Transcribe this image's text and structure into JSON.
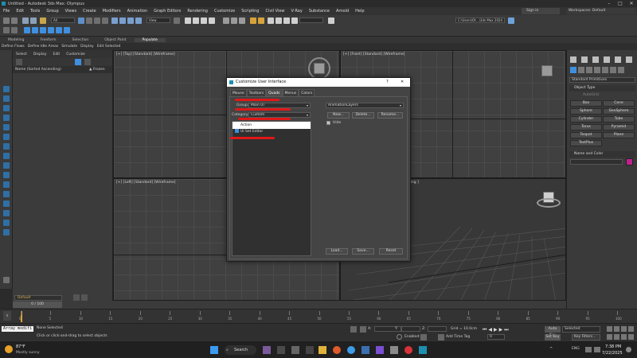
{
  "window": {
    "title": "Untitled - Autodesk 3ds Max: Olympus"
  },
  "menu": {
    "items": [
      "File",
      "Edit",
      "Tools",
      "Group",
      "Views",
      "Create",
      "Modifiers",
      "Animation",
      "Graph Editors",
      "Rendering",
      "Customize",
      "Scripting",
      "Civil View",
      "V-Ray",
      "Substance",
      "Arnold",
      "Help"
    ],
    "signin": "Sign in",
    "workspaces_label": "Workspaces:",
    "workspace_value": "Default"
  },
  "toolbar": {
    "filter_value": "All",
    "view_value": "View",
    "path_value": "C:\\Users\\Ot...\\3ds Max 2024"
  },
  "ribbon": {
    "tabs": [
      "Modeling",
      "Freeform",
      "Selection",
      "Object Paint",
      "Populate"
    ],
    "active": "Populate",
    "sub_items": [
      "Define Flows",
      "Define Idle Areas",
      "Simulate",
      "Display",
      "Edit Selected"
    ]
  },
  "explorer": {
    "tabs": [
      "Select",
      "Display",
      "Edit",
      "Customize"
    ],
    "column_name": "Name (Sorted Ascending)",
    "column_frozen": "▲ Frozen"
  },
  "viewports": {
    "top": "[+] [Top] [Standard] [Wireframe]",
    "front": "[+] [Front] [Standard] [Wireframe]",
    "left": "[+] [Left] [Standard] [Wireframe]",
    "persp_suffix": "ading ]"
  },
  "command_panel": {
    "category_value": "Standard Primitives",
    "object_type_header": "Object Type",
    "autogrid": "AutoGrid",
    "buttons": [
      "Box",
      "Cone",
      "Sphere",
      "GeoSphere",
      "Cylinder",
      "Tube",
      "Torus",
      "Pyramid",
      "Teapot",
      "Plane",
      "TextPlus"
    ],
    "name_color_header": "Name and Color",
    "name_color_swatch": "#c0218f"
  },
  "dialog": {
    "title": "Customize User Interface",
    "help": "?",
    "close": "✕",
    "tabs": [
      "Mouse",
      "Toolbars",
      "Quads",
      "Menus",
      "Colors"
    ],
    "active_tab": "Quads",
    "group_label": "Group:",
    "group_value": "Main UI",
    "category_label": "Category:",
    "category_value": "Custom",
    "list_header": "Action",
    "list_items": [
      "UI Set Editor"
    ],
    "right_dropdown": "AnimationLayers",
    "new_btn": "New...",
    "delete_btn": "Delete...",
    "rename_btn": "Rename...",
    "hide_label": "Hide",
    "load_btn": "Load...",
    "save_btn": "Save...",
    "reset_btn": "Reset"
  },
  "timeline": {
    "frame_display": "0 / 100",
    "ticks": [
      "0",
      "5",
      "10",
      "15",
      "20",
      "25",
      "30",
      "35",
      "40",
      "45",
      "50",
      "55",
      "60",
      "65",
      "70",
      "75",
      "80",
      "85",
      "90",
      "95",
      "100"
    ]
  },
  "status": {
    "layer_value": "Default",
    "none_selected": "None Selected",
    "hint": "Click or click-and-drag to select objects",
    "script": "Array modifi",
    "x_label": "X:",
    "y_label": "Y:",
    "z_label": "Z:",
    "grid": "Grid = 10.0cm",
    "enabled": "Enabled:",
    "add_time_tag": "Add Time Tag",
    "auto_key": "Auto Key",
    "set_key": "Set Key",
    "selected_value": "Selected",
    "key_filters": "Key Filters...",
    "frame_value": "0"
  },
  "taskbar": {
    "weather_temp": "87°F",
    "weather_desc": "Mostly sunny",
    "search": "Search",
    "time": "7:38 PM",
    "date": "7/22/2025",
    "lang": "ENG"
  }
}
